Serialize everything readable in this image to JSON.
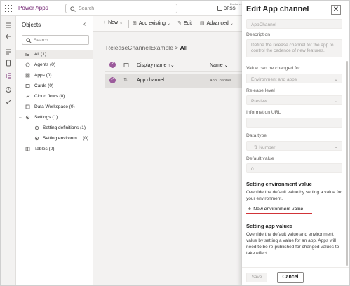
{
  "header": {
    "app_name": "Power Apps",
    "search_placeholder": "Search",
    "environment_label": "Environ…",
    "environment_name": "DRSS"
  },
  "objects_pane": {
    "title": "Objects",
    "search_placeholder": "Search",
    "items": [
      {
        "label": "All",
        "count": "(1)"
      },
      {
        "label": "Agents",
        "count": "(0)"
      },
      {
        "label": "Apps",
        "count": "(0)"
      },
      {
        "label": "Cards",
        "count": "(0)"
      },
      {
        "label": "Cloud flows",
        "count": "(0)"
      },
      {
        "label": "Data Workspace",
        "count": "(0)"
      },
      {
        "label": "Settings",
        "count": "(1)"
      },
      {
        "label": "Setting definitions",
        "count": "(1)"
      },
      {
        "label": "Setting environm…",
        "count": "(0)"
      },
      {
        "label": "Tables",
        "count": "(0)"
      }
    ]
  },
  "commandbar": {
    "new": "New",
    "add_existing": "Add existing",
    "edit": "Edit",
    "advanced": "Advanced"
  },
  "breadcrumb": {
    "parent": "ReleaseChannelExample",
    "separator": ">",
    "current": "All"
  },
  "grid": {
    "columns": {
      "display_name": "Display name",
      "name": "Name"
    },
    "rows": [
      {
        "display_name": "App channel",
        "name": "AppChannel"
      }
    ]
  },
  "panel": {
    "title": "Edit App channel",
    "name_value": "AppChannel",
    "description_label": "Description",
    "description_value": "Define the release channel for the app to control the cadence of new features.",
    "value_changed_label": "Value can be changed for",
    "value_changed_value": "Environment and apps",
    "release_level_label": "Release level",
    "release_level_value": "Preview",
    "info_url_label": "Information URL",
    "info_url_value": "",
    "data_type_label": "Data type",
    "data_type_value": "Number",
    "default_value_label": "Default value",
    "default_value_value": "0",
    "env_section_title": "Setting environment value",
    "env_section_text": "Override the default value by setting a value for your environment.",
    "new_env_value_button": "New environment value",
    "app_section_title": "Setting app values",
    "app_section_text": "Override the default value and environment value by setting a value for an app. Apps will need to be re-published for changed values to take effect.",
    "save_label": "Save",
    "cancel_label": "Cancel"
  },
  "colors": {
    "brand": "#742774",
    "selected_check": "#9b5a9b",
    "annotation_red": "#d13438"
  }
}
